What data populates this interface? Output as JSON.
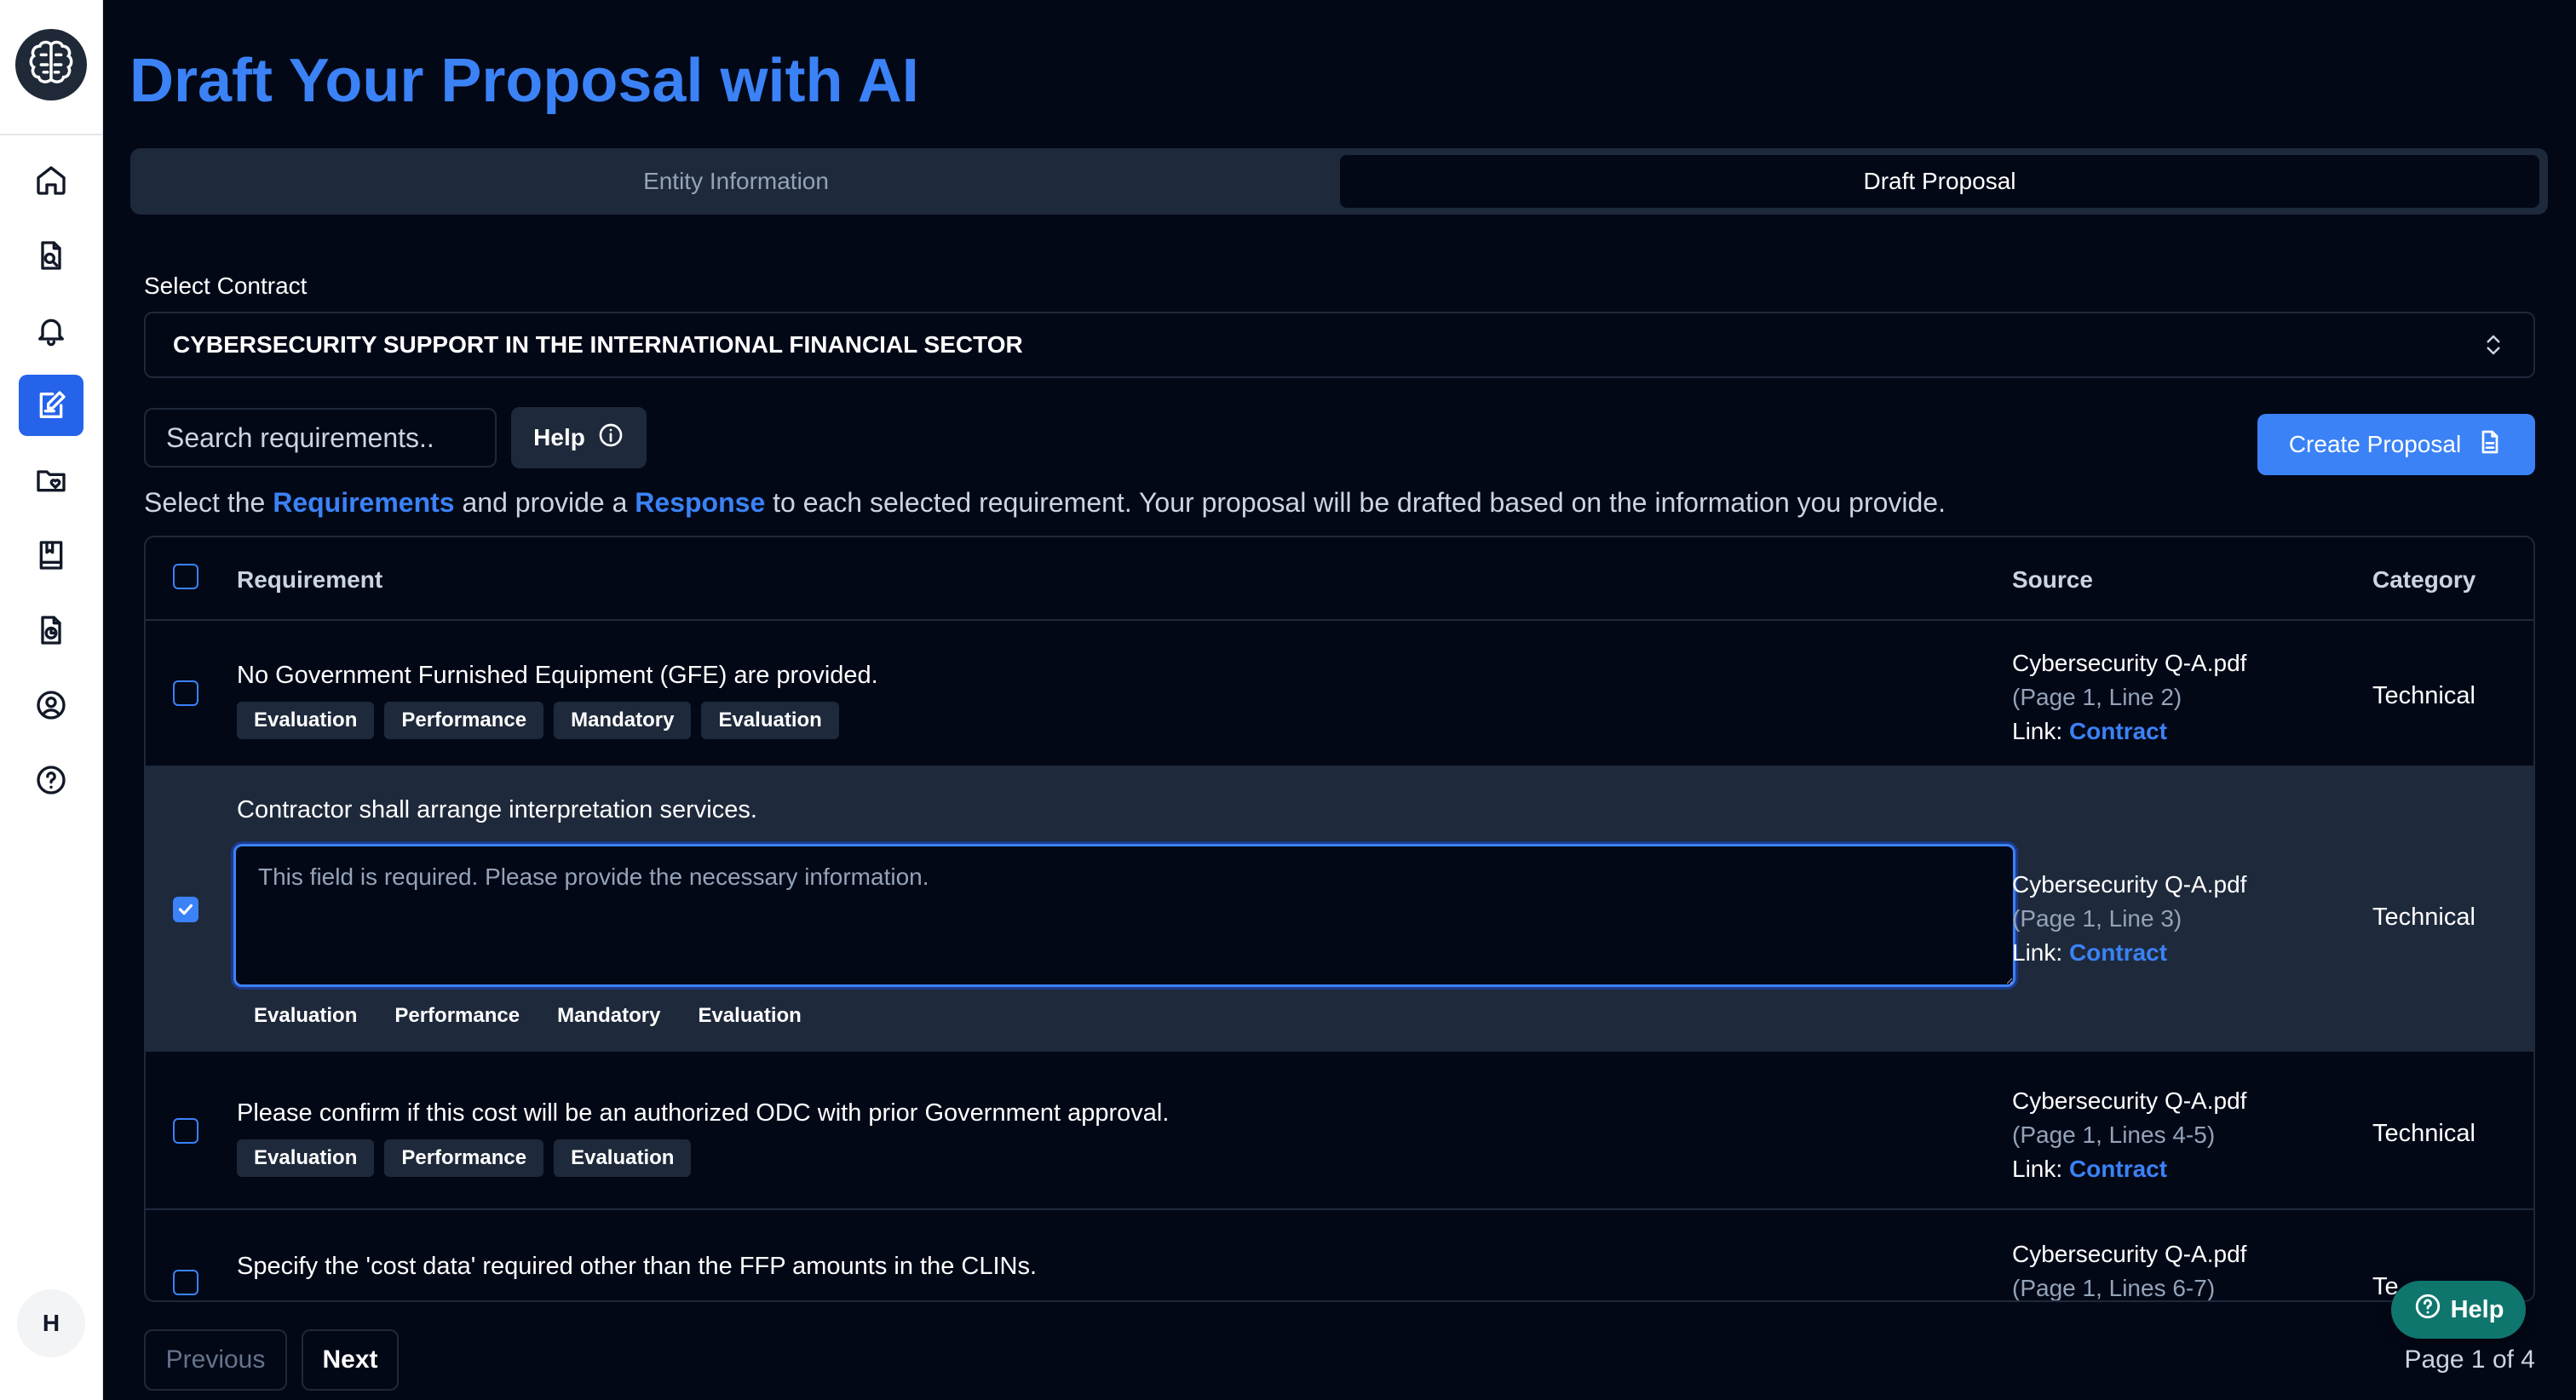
{
  "page": {
    "title": "Draft Your Proposal with AI"
  },
  "tabs": [
    {
      "label": "Entity Information",
      "active": false
    },
    {
      "label": "Draft Proposal",
      "active": true
    }
  ],
  "sidebar": {
    "items": [
      {
        "icon": "home-icon"
      },
      {
        "icon": "file-search-icon"
      },
      {
        "icon": "bell-icon"
      },
      {
        "icon": "edit-document-icon",
        "active": true
      },
      {
        "icon": "folder-heart-icon"
      },
      {
        "icon": "book-icon"
      },
      {
        "icon": "file-chart-icon"
      },
      {
        "icon": "user-circle-icon"
      },
      {
        "icon": "help-circle-icon"
      }
    ],
    "avatar_initial": "H"
  },
  "contract": {
    "label": "Select Contract",
    "selected": "CYBERSECURITY SUPPORT IN THE INTERNATIONAL FINANCIAL SECTOR"
  },
  "search": {
    "placeholder": "Search requirements.."
  },
  "help_button": "Help",
  "create_button": "Create Proposal",
  "instructions": {
    "part1": "Select the ",
    "req": "Requirements",
    "part2": " and provide a ",
    "resp": "Response",
    "part3": " to each selected requirement. Your proposal will be drafted based on the information you provide."
  },
  "table": {
    "headers": {
      "requirement": "Requirement",
      "source": "Source",
      "category": "Category"
    },
    "rows": [
      {
        "text": "No Government Furnished Equipment (GFE) are provided.",
        "tags": [
          "Evaluation",
          "Performance",
          "Mandatory",
          "Evaluation"
        ],
        "source_file": "Cybersecurity Q-A.pdf",
        "source_page": "(Page 1, Line 2)",
        "link_label": "Link: ",
        "link_text": "Contract",
        "category": "Technical",
        "checked": false
      },
      {
        "text": "Contractor shall arrange interpretation services.",
        "response_placeholder": "This field is required. Please provide the necessary information.",
        "tags": [
          "Evaluation",
          "Performance",
          "Mandatory",
          "Evaluation"
        ],
        "source_file": "Cybersecurity Q-A.pdf",
        "source_page": "(Page 1, Line 3)",
        "link_label": "Link: ",
        "link_text": "Contract",
        "category": "Technical",
        "checked": true
      },
      {
        "text": "Please confirm if this cost will be an authorized ODC with prior Government approval.",
        "tags": [
          "Evaluation",
          "Performance",
          "Evaluation"
        ],
        "source_file": "Cybersecurity Q-A.pdf",
        "source_page": "(Page 1, Lines 4-5)",
        "link_label": "Link: ",
        "link_text": "Contract",
        "category": "Technical",
        "checked": false
      },
      {
        "text": "Specify the 'cost data' required other than the FFP amounts in the CLINs.",
        "source_file": "Cybersecurity Q-A.pdf",
        "source_page": "(Page 1, Lines 6-7)",
        "category": "Te",
        "checked": false
      }
    ]
  },
  "pagination": {
    "previous": "Previous",
    "next": "Next",
    "info": "Page 1 of 4"
  },
  "fab_help": "Help",
  "colors": {
    "accent": "#3b82f6",
    "background": "#030817",
    "panel": "#1e293b",
    "help_fab": "#0f766e"
  }
}
